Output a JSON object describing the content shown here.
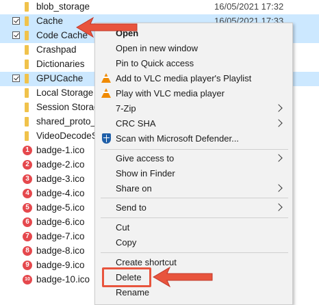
{
  "colors": {
    "selection": "#cce8ff",
    "folder": "#f0c24b",
    "badge": "#e5484d",
    "callout_arrow": "#e8543d",
    "vlc": "#f08a00",
    "defender": "#1f5fa8"
  },
  "files": [
    {
      "name": "blob_storage",
      "date": "16/05/2021 17:32",
      "icon": "folder-icon",
      "selected": false
    },
    {
      "name": "Cache",
      "date": "16/05/2021 17:33",
      "icon": "folder-icon",
      "selected": true
    },
    {
      "name": "Code Cache",
      "date": "",
      "icon": "folder-icon",
      "selected": true
    },
    {
      "name": "Crashpad",
      "date": "",
      "icon": "folder-icon",
      "selected": false
    },
    {
      "name": "Dictionaries",
      "date": "",
      "icon": "folder-icon",
      "selected": false
    },
    {
      "name": "GPUCache",
      "date": "",
      "icon": "folder-icon",
      "selected": true
    },
    {
      "name": "Local Storage",
      "date": "",
      "icon": "folder-icon",
      "selected": false
    },
    {
      "name": "Session Storage",
      "date": "",
      "icon": "folder-icon",
      "selected": false
    },
    {
      "name": "shared_proto_d",
      "date": "",
      "icon": "folder-icon",
      "selected": false
    },
    {
      "name": "VideoDecodeSt",
      "date": "",
      "icon": "folder-icon",
      "selected": false
    },
    {
      "name": "badge-1.ico",
      "date": "",
      "icon": "badge-icon",
      "badge_num": "1",
      "selected": false
    },
    {
      "name": "badge-2.ico",
      "date": "",
      "icon": "badge-icon",
      "badge_num": "2",
      "selected": false
    },
    {
      "name": "badge-3.ico",
      "date": "",
      "icon": "badge-icon",
      "badge_num": "3",
      "selected": false
    },
    {
      "name": "badge-4.ico",
      "date": "",
      "icon": "badge-icon",
      "badge_num": "4",
      "selected": false
    },
    {
      "name": "badge-5.ico",
      "date": "",
      "icon": "badge-icon",
      "badge_num": "5",
      "selected": false
    },
    {
      "name": "badge-6.ico",
      "date": "",
      "icon": "badge-icon",
      "badge_num": "6",
      "selected": false
    },
    {
      "name": "badge-7.ico",
      "date": "",
      "icon": "badge-icon",
      "badge_num": "7",
      "selected": false
    },
    {
      "name": "badge-8.ico",
      "date": "",
      "icon": "badge-icon",
      "badge_num": "8",
      "selected": false
    },
    {
      "name": "badge-9.ico",
      "date": "",
      "icon": "badge-icon",
      "badge_num": "9",
      "selected": false
    },
    {
      "name": "badge-10.ico",
      "date": "",
      "icon": "badge-icon",
      "badge_num": "10",
      "selected": false
    }
  ],
  "context_menu": {
    "items": [
      {
        "label": "Open",
        "bold": true,
        "icon": "",
        "submenu": false
      },
      {
        "label": "Open in new window",
        "bold": false,
        "icon": "",
        "submenu": false
      },
      {
        "label": "Pin to Quick access",
        "bold": false,
        "icon": "",
        "submenu": false
      },
      {
        "label": "Add to VLC media player's Playlist",
        "bold": false,
        "icon": "vlc-icon",
        "submenu": false
      },
      {
        "label": "Play with VLC media player",
        "bold": false,
        "icon": "vlc-icon",
        "submenu": false
      },
      {
        "label": "7-Zip",
        "bold": false,
        "icon": "",
        "submenu": true
      },
      {
        "label": "CRC SHA",
        "bold": false,
        "icon": "",
        "submenu": true
      },
      {
        "label": "Scan with Microsoft Defender...",
        "bold": false,
        "icon": "defender-icon",
        "submenu": false
      },
      {
        "label": "Give access to",
        "bold": false,
        "icon": "",
        "submenu": true
      },
      {
        "label": "Show in Finder",
        "bold": false,
        "icon": "",
        "submenu": false
      },
      {
        "label": "Share on",
        "bold": false,
        "icon": "",
        "submenu": true
      },
      {
        "label": "Send to",
        "bold": false,
        "icon": "",
        "submenu": true
      },
      {
        "label": "Cut",
        "bold": false,
        "icon": "",
        "submenu": false
      },
      {
        "label": "Copy",
        "bold": false,
        "icon": "",
        "submenu": false
      },
      {
        "label": "Create shortcut",
        "bold": false,
        "icon": "",
        "submenu": false
      },
      {
        "label": "Delete",
        "bold": false,
        "icon": "",
        "submenu": false
      },
      {
        "label": "Rename",
        "bold": false,
        "icon": "",
        "submenu": false
      }
    ]
  },
  "annotations": [
    {
      "target": "Cache",
      "icon": "arrow-left-icon"
    },
    {
      "target": "Delete",
      "icon": "arrow-left-icon"
    }
  ]
}
